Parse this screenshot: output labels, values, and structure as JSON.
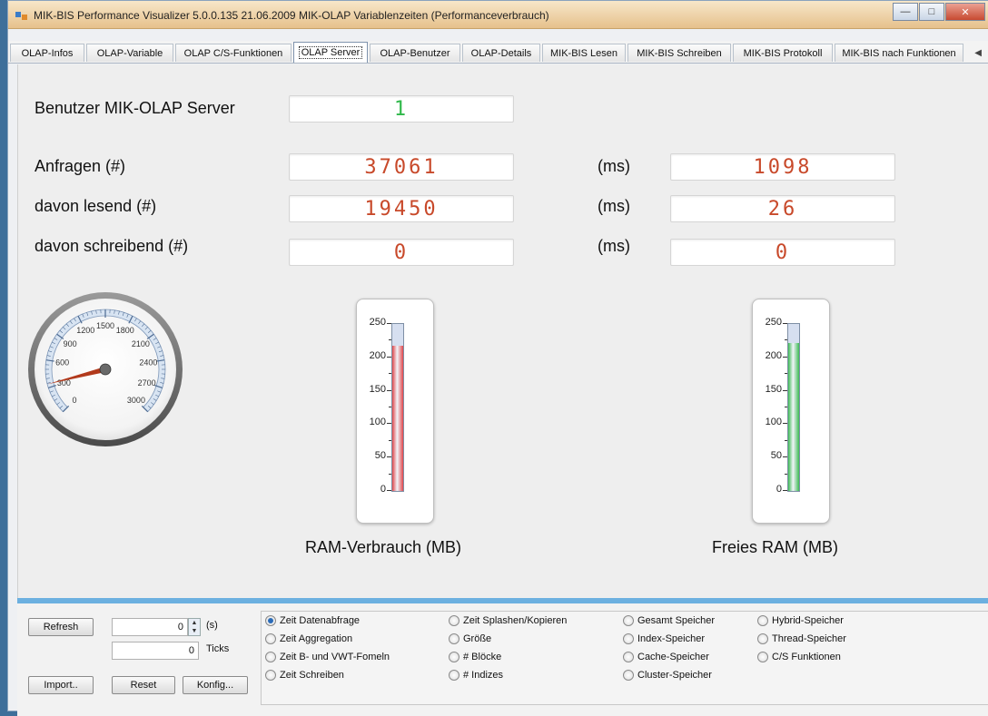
{
  "window": {
    "title": "MIK-BIS Performance Visualizer   5.0.0.135  21.06.2009   MIK-OLAP Variablenzeiten (Performanceverbrauch)"
  },
  "tabs": [
    {
      "label": "OLAP-Infos"
    },
    {
      "label": "OLAP-Variable"
    },
    {
      "label": "OLAP C/S-Funktionen"
    },
    {
      "label": "OLAP Server",
      "active": true
    },
    {
      "label": "OLAP-Benutzer"
    },
    {
      "label": "OLAP-Details"
    },
    {
      "label": "MIK-BIS Lesen"
    },
    {
      "label": "MIK-BIS Schreiben"
    },
    {
      "label": "MIK-BIS Protokoll"
    },
    {
      "label": "MIK-BIS nach Funktionen"
    }
  ],
  "stats": {
    "users_label": "Benutzer MIK-OLAP Server",
    "users_value": "1",
    "requests_label": "Anfragen (#)",
    "requests_value": "37061",
    "requests_ms_label": "(ms)",
    "requests_ms_value": "1098",
    "reading_label": "davon lesend (#)",
    "reading_value": "19450",
    "reading_ms_label": "(ms)",
    "reading_ms_value": "26",
    "writing_label": "davon schreibend (#)",
    "writing_value": "0",
    "writing_ms_label": "(ms)",
    "writing_ms_value": "0"
  },
  "gauge": {
    "min": 0,
    "max": 3000,
    "value": 340,
    "labels": [
      "0",
      "300",
      "600",
      "900",
      "1200",
      "1500",
      "1800",
      "2100",
      "2400",
      "2700",
      "3000"
    ]
  },
  "ram_used": {
    "caption": "RAM-Verbrauch (MB)",
    "max": 250,
    "value": 217,
    "fill_color": "#e0474b",
    "ticks": [
      "250",
      "200",
      "150",
      "100",
      "50",
      "0"
    ]
  },
  "ram_free": {
    "caption": "Freies RAM (MB)",
    "max": 250,
    "value": 221,
    "fill_color": "#3dbb55",
    "ticks": [
      "250",
      "200",
      "150",
      "100",
      "50",
      "0"
    ]
  },
  "controls": {
    "refresh": "Refresh",
    "interval_value": "0",
    "interval_unit": "(s)",
    "ticks_value": "0",
    "ticks_label": "Ticks",
    "import": "Import..",
    "reset": "Reset",
    "config": "Konfig..."
  },
  "options": [
    {
      "label": "Zeit Datenabfrage",
      "selected": true
    },
    {
      "label": "Zeit Aggregation"
    },
    {
      "label": "Zeit B-  und VWT-Fomeln"
    },
    {
      "label": "Zeit Schreiben"
    },
    {
      "label": "Zeit Splashen/Kopieren"
    },
    {
      "label": "Größe"
    },
    {
      "label": "# Blöcke"
    },
    {
      "label": "# Indizes"
    },
    {
      "label": "Gesamt Speicher"
    },
    {
      "label": "Index-Speicher"
    },
    {
      "label": "Cache-Speicher"
    },
    {
      "label": "Cluster-Speicher"
    },
    {
      "label": "Hybrid-Speicher"
    },
    {
      "label": "Thread-Speicher"
    },
    {
      "label": "C/S Funktionen"
    }
  ]
}
